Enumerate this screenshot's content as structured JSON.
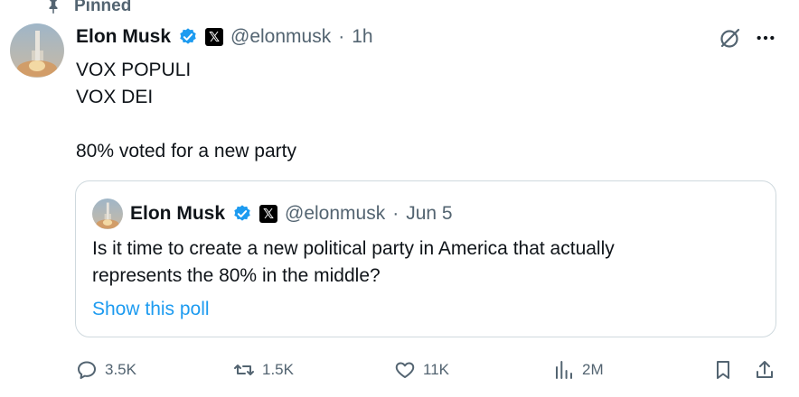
{
  "pinned": {
    "label": "Pinned"
  },
  "tweet": {
    "author_name": "Elon Musk",
    "handle": "@elonmusk",
    "separator": "·",
    "time": "1h",
    "body_lines": [
      "VOX POPULI",
      "VOX DEI",
      "",
      "80% voted for a new party"
    ]
  },
  "quote": {
    "author_name": "Elon Musk",
    "handle": "@elonmusk",
    "separator": "·",
    "time": "Jun 5",
    "text_lines": [
      "Is it time to create a new political party in America that actually",
      "represents the 80% in the middle?"
    ],
    "show_poll": "Show this poll"
  },
  "actions": {
    "replies": "3.5K",
    "reposts": "1.5K",
    "likes": "11K",
    "views": "2M"
  },
  "badges": {
    "x_badge": "𝕏"
  },
  "colors": {
    "verified": "#1d9bf0",
    "link": "#1d9bf0",
    "secondary_text": "#536471",
    "border": "#cfd9de"
  },
  "icons": {
    "pin": "pin-icon",
    "verified": "verified-badge-icon",
    "grok": "grok-icon",
    "more": "more-icon",
    "reply": "reply-icon",
    "repost": "repost-icon",
    "like": "heart-icon",
    "views": "views-chart-icon",
    "bookmark": "bookmark-icon",
    "share": "share-icon"
  }
}
